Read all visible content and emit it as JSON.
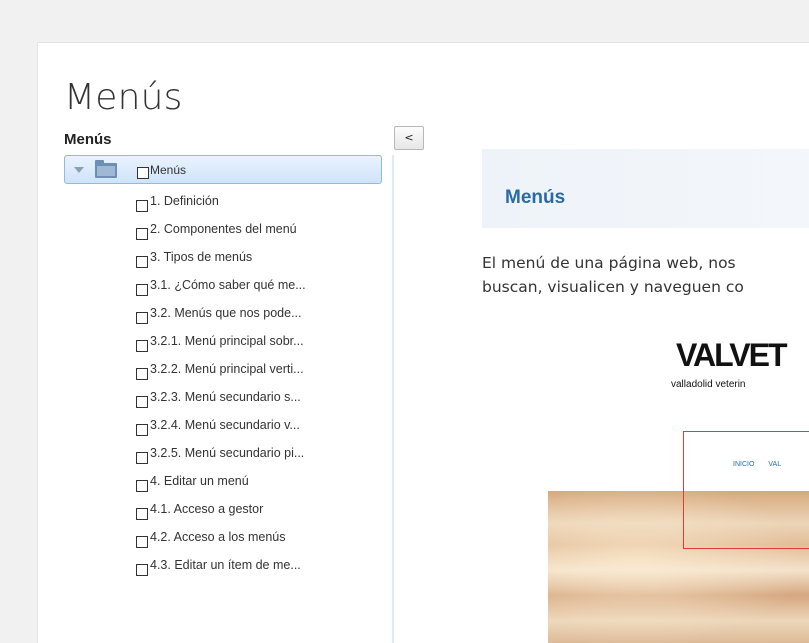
{
  "page": {
    "title": "Menús"
  },
  "toc": {
    "heading": "Menús",
    "collapse_label": "<",
    "root": {
      "label": "Menús"
    },
    "items": [
      {
        "label": "1. Definición"
      },
      {
        "label": "2. Componentes del menú"
      },
      {
        "label": "3. Tipos de menús"
      },
      {
        "label": "3.1. ¿Cómo saber qué me..."
      },
      {
        "label": "3.2. Menús que nos pode..."
      },
      {
        "label": "3.2.1. Menú principal sobr..."
      },
      {
        "label": "3.2.2. Menú principal verti..."
      },
      {
        "label": "3.2.3. Menú secundario s..."
      },
      {
        "label": "3.2.4. Menú secundario v..."
      },
      {
        "label": "3.2.5. Menú secundario pi..."
      },
      {
        "label": "4. Editar un menú"
      },
      {
        "label": "4.1. Acceso a gestor"
      },
      {
        "label": "4.2. Acceso a los menús"
      },
      {
        "label": "4.3. Editar un ítem de me..."
      }
    ]
  },
  "content": {
    "section_title": "Menús",
    "paragraph_lines": [
      "El menú de una página web, nos",
      "buscan, visualicen y naveguen co"
    ],
    "image": {
      "logo_text": "VALVET",
      "logo_subtitle": "valladolid veterin",
      "nav_items": [
        "INICIO",
        "VAL"
      ]
    }
  },
  "colors": {
    "accent": "#2a6aa8",
    "selection": "#cfe3f9",
    "highlight_box": "#e53935"
  }
}
